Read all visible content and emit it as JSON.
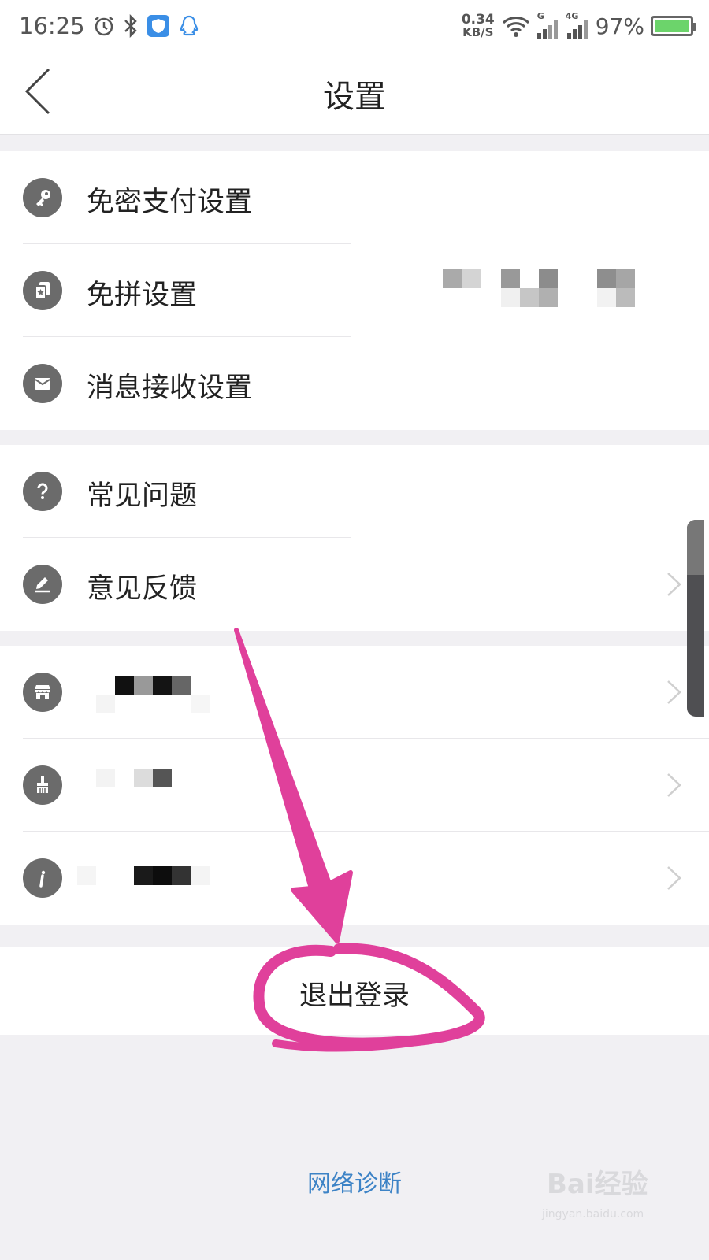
{
  "status": {
    "time": "16:25",
    "speed_value": "0.34",
    "speed_unit": "KB/S",
    "sim1": "G",
    "sim2": "4G",
    "battery": "97%"
  },
  "nav": {
    "title": "设置"
  },
  "groups": [
    {
      "items": [
        {
          "label": "免密支付设置",
          "icon": "key-icon"
        },
        {
          "label": "免拼设置",
          "icon": "cards-icon"
        },
        {
          "label": "消息接收设置",
          "icon": "mail-icon"
        }
      ]
    },
    {
      "items": [
        {
          "label": "常见问题",
          "icon": "question-icon"
        },
        {
          "label": "意见反馈",
          "icon": "edit-icon"
        }
      ]
    },
    {
      "items": [
        {
          "label": "",
          "icon": "store-icon"
        },
        {
          "label": "",
          "icon": "broom-icon"
        },
        {
          "label": "",
          "icon": "info-icon"
        }
      ]
    }
  ],
  "logout": {
    "label": "退出登录"
  },
  "footer": {
    "diagnose": "网络诊断"
  },
  "watermark": {
    "brand": "Bai经验",
    "url": "jingyan.baidu.com"
  },
  "colors": {
    "accent_link": "#3d83c6",
    "annotation": "#e0409b",
    "icon_gray": "#6b6b6b"
  }
}
